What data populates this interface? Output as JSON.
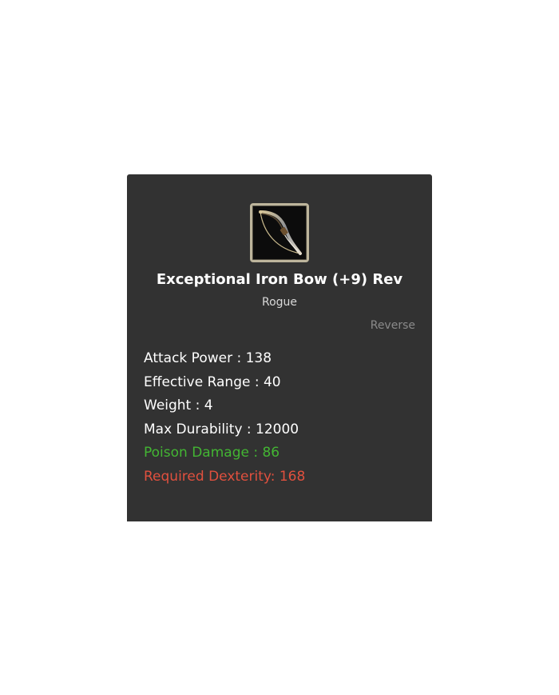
{
  "item": {
    "icon": "bow-icon",
    "name": "Exceptional Iron Bow (+9) Rev",
    "class": "Rogue",
    "reverse_label": "Reverse"
  },
  "stats": {
    "attack_power": "Attack Power : 138",
    "effective_range": "Effective Range : 40",
    "weight": "Weight : 4",
    "max_durability": "Max Durability : 12000",
    "poison_damage": "Poison Damage : 86",
    "required_dexterity": "Required Dexterity: 168"
  },
  "colors": {
    "panel_background": "#323232",
    "poison": "#43b533",
    "requirement": "#e0503e",
    "muted": "#8a8a8a"
  }
}
